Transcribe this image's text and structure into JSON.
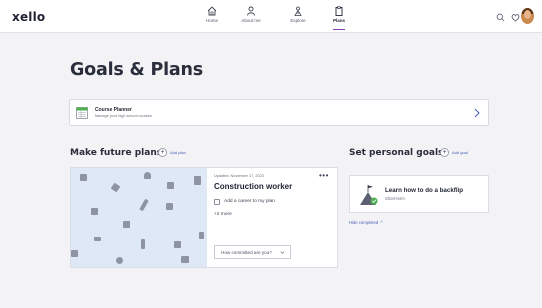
{
  "app": {
    "logo": "xello"
  },
  "nav": [
    {
      "label": "Home",
      "icon": "home-icon",
      "active": false
    },
    {
      "label": "About me",
      "icon": "person-icon",
      "active": false
    },
    {
      "label": "Explore",
      "icon": "explore-icon",
      "active": false
    },
    {
      "label": "Plans",
      "icon": "clipboard-icon",
      "active": true
    }
  ],
  "topbar_icons": [
    "search-icon",
    "heart-icon"
  ],
  "page": {
    "title": "Goals & Plans"
  },
  "course_planner": {
    "title": "Course Planner",
    "subtitle": "Manage your high school courses"
  },
  "future_plans": {
    "heading": "Make future plans",
    "add_label": "Add plan",
    "card": {
      "updated": "Updated: November 17, 2023",
      "title": "Construction worker",
      "add_career_label": "Add a career to my plan",
      "extra": "+2 more",
      "commitment_placeholder": "How committed are you?"
    }
  },
  "personal_goals": {
    "heading": "Set personal goals",
    "add_label": "Add goal",
    "goal": {
      "title": "Learn how to do a backflip",
      "term": "Short-term"
    },
    "hide_completed": "Hide completed"
  },
  "colors": {
    "accent": "#8c3fb4",
    "link": "#4a5db8",
    "background": "#f3f3f5",
    "card_art": "#dfe8f6"
  }
}
